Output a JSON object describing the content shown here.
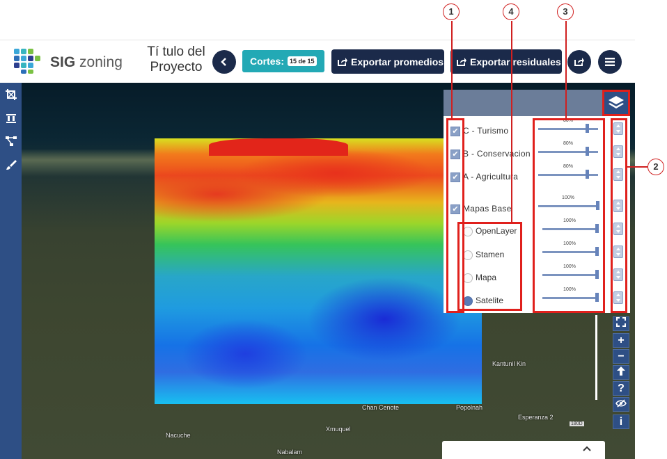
{
  "header": {
    "brand_bold": "SIG",
    "brand_rest": "zoning",
    "project_title": "Tí tulo del Proyecto",
    "cortes_label": "Cortes:",
    "cortes_badge": "15 de 15",
    "export_averages": "Exportar promedios",
    "export_residuals": "Exportar residuales"
  },
  "layers": {
    "items": [
      {
        "label": "C - Turismo",
        "checked": true,
        "opacity": "80%"
      },
      {
        "label": "B - Conservacion",
        "checked": true,
        "opacity": "80%"
      },
      {
        "label": "A - Agricultura",
        "checked": true,
        "opacity": "80%"
      },
      {
        "label": "Mapas Base",
        "checked": true,
        "opacity": "100%"
      }
    ],
    "basemaps": [
      {
        "label": "OpenLayer",
        "selected": false,
        "opacity": "100%"
      },
      {
        "label": "Stamen",
        "selected": false,
        "opacity": "100%"
      },
      {
        "label": "Mapa",
        "selected": false,
        "opacity": "100%"
      },
      {
        "label": "Satelite",
        "selected": true,
        "opacity": "100%"
      }
    ]
  },
  "callouts": {
    "one": "1",
    "two": "2",
    "three": "3",
    "four": "4"
  },
  "map_controls": {
    "zoom_in": "+",
    "zoom_out": "−",
    "help": "?",
    "info": "i"
  },
  "places": {
    "kantunil": "Kantunil Kin",
    "chan_cenote": "Chan Cenote",
    "popolnah": "Popolnah",
    "esperanza": "Esperanza 2",
    "nacuche": "Nacuche",
    "xmuquel": "Xmuquel",
    "nabalam": "Nabalam",
    "road": "180D"
  },
  "colors": {
    "navy": "#1b2a4a",
    "teal": "#23a9b5",
    "toolbar_blue": "#2e4f85",
    "callout_red": "#e0201c"
  }
}
